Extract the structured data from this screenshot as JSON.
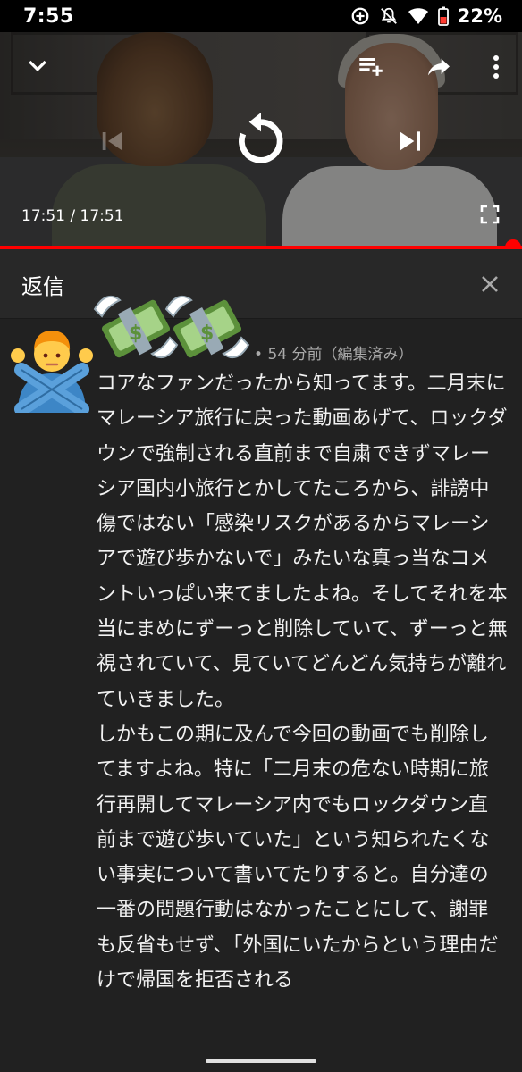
{
  "status_bar": {
    "time": "7:55",
    "battery_percent": "22%",
    "icons": [
      "data-saver-icon",
      "mute-icon",
      "wifi-icon",
      "battery-icon"
    ]
  },
  "player": {
    "time_display": "17:51 / 17:51",
    "progress_fraction": 1.0,
    "icons": [
      "chevron-down-icon",
      "add-to-queue-icon",
      "share-icon",
      "more-icon",
      "previous-icon",
      "replay-icon",
      "next-icon",
      "fullscreen-icon"
    ]
  },
  "panel": {
    "title": "返信"
  },
  "comment": {
    "time_ago": "54 分前（編集済み）",
    "separator": "•",
    "text": "コアなファンだったから知ってます。二月末にマレーシア旅行に戻った動画あげて、ロックダウンで強制される直前まで自粛できずマレーシア国内小旅行とかしてたころから、誹謗中傷ではない「感染リスクがあるからマレーシアで遊び歩かないで」みたいな真っ当なコメントいっぱい来てましたよね。そしてそれを本当にまめにずーっと削除していて、ずーっと無視されていて、見ていてどんどん気持ちが離れていきました。\nしかもこの期に及んで今回の動画でも削除してますよね。特に「二月末の危ない時期に旅行再開してマレーシア内でもロックダウン直前まで遊び歩いていた」という知られたくない事実について書いてたりすると。自分達の一番の問題行動はなかったことにして、謝罪も反省もせず、「外国にいたからという理由だけで帰国を拒否される"
  },
  "colors": {
    "background": "#212121",
    "header": "#282828",
    "accent_red": "#ff0000",
    "text_primary": "#f1f1f1",
    "text_secondary": "#aaaaaa"
  }
}
